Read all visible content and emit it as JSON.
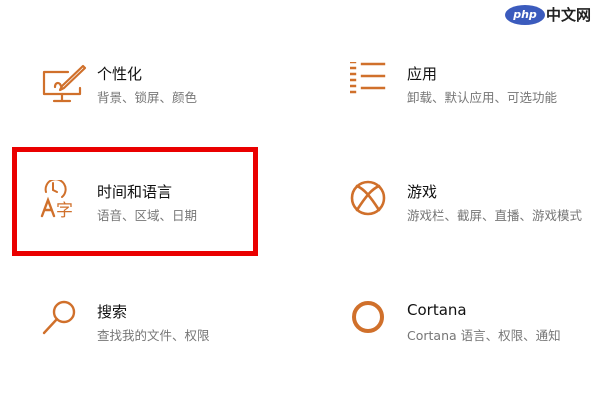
{
  "accent_color": "#d0702b",
  "highlight_color": "#ea0000",
  "watermark": {
    "logo": "php",
    "text": "中文网"
  },
  "tiles": [
    {
      "title": "个性化",
      "desc": "背景、锁屏、颜色",
      "icon": "personalization-icon"
    },
    {
      "title": "应用",
      "desc": "卸载、默认应用、可选功能",
      "icon": "apps-list-icon"
    },
    {
      "title": "时间和语言",
      "desc": "语音、区域、日期",
      "icon": "time-language-icon",
      "icon_glyph": "字"
    },
    {
      "title": "游戏",
      "desc": "游戏栏、截屏、直播、游戏模式",
      "icon": "xbox-icon"
    },
    {
      "title": "搜索",
      "desc": "查找我的文件、权限",
      "icon": "search-icon"
    },
    {
      "title": "Cortana",
      "desc": "Cortana 语言、权限、通知",
      "icon": "cortana-ring-icon"
    }
  ]
}
